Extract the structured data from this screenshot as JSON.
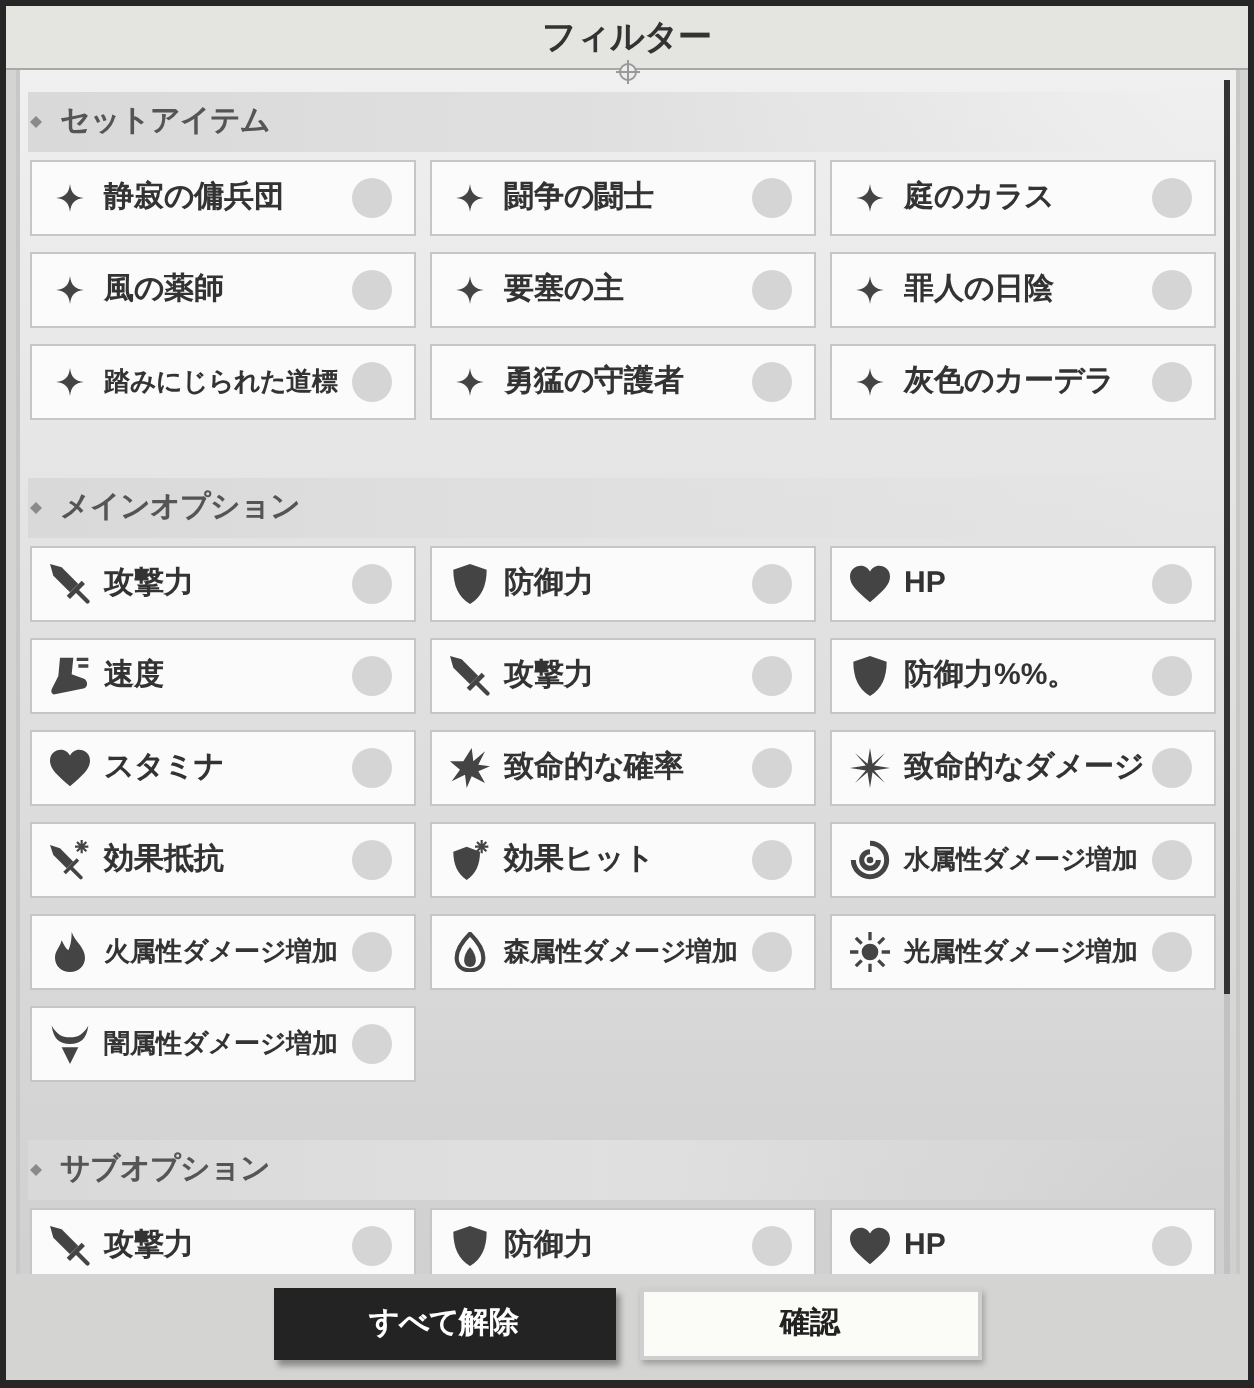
{
  "window": {
    "title": "フィルター"
  },
  "sections": [
    {
      "title": "セットアイテム",
      "items": [
        {
          "label": "静寂の傭兵団",
          "selected": false
        },
        {
          "label": "闘争の闘士",
          "selected": false
        },
        {
          "label": "庭のカラス",
          "selected": false
        },
        {
          "label": "風の薬師",
          "selected": false
        },
        {
          "label": "要塞の主",
          "selected": false
        },
        {
          "label": "罪人の日陰",
          "selected": false
        },
        {
          "label": "踏みにじられた道標",
          "selected": false
        },
        {
          "label": "勇猛の守護者",
          "selected": false
        },
        {
          "label": "灰色のカーデラ",
          "selected": false
        }
      ]
    },
    {
      "title": "メインオプション",
      "items": [
        {
          "label": "攻撃力",
          "kind": "attack",
          "selected": false
        },
        {
          "label": "防御力",
          "kind": "defense",
          "selected": false
        },
        {
          "label": "HP",
          "kind": "health",
          "selected": false
        },
        {
          "label": "速度",
          "kind": "speed",
          "selected": false
        },
        {
          "label": "攻撃力",
          "kind": "attack",
          "selected": false
        },
        {
          "label": "防御力%%。",
          "kind": "defense",
          "selected": false
        },
        {
          "label": "スタミナ",
          "kind": "stamina",
          "selected": false
        },
        {
          "label": "致命的な確率",
          "kind": "critrate",
          "selected": false
        },
        {
          "label": "致命的なダメージ",
          "kind": "critdamage",
          "selected": false
        },
        {
          "label": "効果抵抗",
          "kind": "resistance",
          "selected": false
        },
        {
          "label": "効果ヒット",
          "kind": "accuracy",
          "selected": false
        },
        {
          "label": "水属性ダメージ増加",
          "kind": "water",
          "selected": false
        },
        {
          "label": "火属性ダメージ増加",
          "kind": "fire",
          "selected": false
        },
        {
          "label": "森属性ダメージ増加",
          "kind": "forest",
          "selected": false
        },
        {
          "label": "光属性ダメージ増加",
          "kind": "light",
          "selected": false
        },
        {
          "label": "闇属性ダメージ増加",
          "kind": "dark",
          "selected": false
        }
      ]
    },
    {
      "title": "サブオプション",
      "items": [
        {
          "label": "攻撃力",
          "kind": "attack",
          "selected": false
        },
        {
          "label": "防御力",
          "kind": "defense",
          "selected": false
        },
        {
          "label": "HP",
          "kind": "health",
          "selected": false
        }
      ]
    }
  ],
  "buttons": [
    {
      "label": "すべて解除",
      "kind": "dark"
    },
    {
      "label": "確認",
      "kind": "light"
    }
  ]
}
